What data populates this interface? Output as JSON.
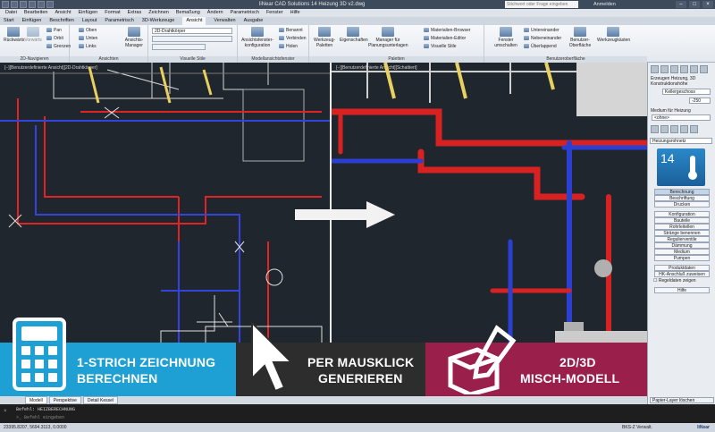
{
  "window": {
    "title": "liNear CAD Solutions 14   Heizung 3D v2.dwg",
    "search_placeholder": "Stichwort oder Frage eingeben",
    "login_label": "Anmelden"
  },
  "menu": [
    "Datei",
    "Bearbeiten",
    "Ansicht",
    "Einfügen",
    "Format",
    "Extras",
    "Zeichnen",
    "Bemaßung",
    "Ändern",
    "Parametrisch",
    "Fenster",
    "Hilfe"
  ],
  "ribbon_tabs": [
    "Start",
    "Einfügen",
    "Beschriften",
    "Layout",
    "Parametrisch",
    "3D-Werkzeuge",
    "Ansicht",
    "Verwalten",
    "Ausgabe"
  ],
  "ribbon_active_tab": "Ansicht",
  "ribbon": {
    "panels": [
      "2D-Navigieren",
      "Ansichten",
      "Visuelle Stile",
      "Modellansichtsfenster",
      "Paletten",
      "Benutzeroberfläche"
    ],
    "nav": {
      "rueckwaerts": "Rückwärts",
      "vorwaerts": "Vorwärts",
      "pan": "Pan",
      "orbit": "Orbit",
      "grenzen": "Grenzen"
    },
    "views": {
      "oben": "Oben",
      "unten": "Unten",
      "links": "Links",
      "manager": "Ansichts-Manager"
    },
    "visual_style": "2D-Drahtkörper",
    "viewport": {
      "config": "Ansichtsfenster-konfiguration",
      "benennt": "Benannt",
      "verbinden": "Verbinden",
      "holen": "Holen"
    },
    "palettes": {
      "werkzeug": "Werkzeug-Paletten",
      "eigenschaften": "Eigenschaften",
      "manager": "Manager für Planungsunterlagen",
      "material_browser": "Materialien-Browser",
      "material_editor": "Materialien-Editor",
      "visuelle_stile": "Visuelle Stile"
    },
    "ui": {
      "fenster": "Fenster umschalten",
      "untereinander": "Untereinander",
      "nebeneinander": "Nebeneinander",
      "ueberlappend": "Überlappend",
      "benutzer": "Benutzer-Oberfläche",
      "werkzeugkasten": "Werkzeugkästen"
    }
  },
  "viewports": {
    "left_label": "[−][Benutzerdefinierte Ansicht][2D-Drahtkörper]",
    "right_label": "[−][Benutzerdefinierte Ansicht][Schattiert]"
  },
  "palette": {
    "header": "Erzeugen Heizung, 3D",
    "sub": "Konstruktionshöhe",
    "storey": "Kellergeschoss",
    "height_value": "-250",
    "medium_label": "Medium für Heizung",
    "medium_value": "<ohne>",
    "system": "Heizungsrohnetz",
    "version": "14",
    "buttons": [
      "Berechnung",
      "Beschriftung",
      "Drucken",
      "Konfiguration",
      "Bauteile",
      "Rohrleitellen",
      "Stränge benennen",
      "Regulierventile",
      "Dämmung",
      "Medium",
      "Pumpen",
      "Produktdaten",
      "HK-Anschluß zuweisen"
    ],
    "selected_button": "Berechnung",
    "checkbox_label": "Regeldaten zeigen",
    "help": "Hilfe",
    "bottom": "Papier-Layer löschen"
  },
  "banner": {
    "seg1_line1": "1-STRICH ZEICHNUNG",
    "seg1_line2": "BERECHNEN",
    "seg2_line1": "PER MAUSKLICK",
    "seg2_line2": "GENERIEREN",
    "seg3_line1": "2D/3D",
    "seg3_line2": "MISCH-MODELL",
    "colors": {
      "blue": "#1ea0d4",
      "dark": "#2d2d2d",
      "magenta": "#9a1f4a"
    }
  },
  "layout_tabs": [
    "Modell",
    "Perspektive",
    "Detail Kessel"
  ],
  "command": {
    "line1": "Befehl: HEIZBERECHNUNG",
    "prompt": "Befehl eingeben"
  },
  "status": {
    "coords": "23395.8207, 5694.3113, 0.0000",
    "right": "BKS-Z Verwalt.",
    "brand": "liNear"
  }
}
